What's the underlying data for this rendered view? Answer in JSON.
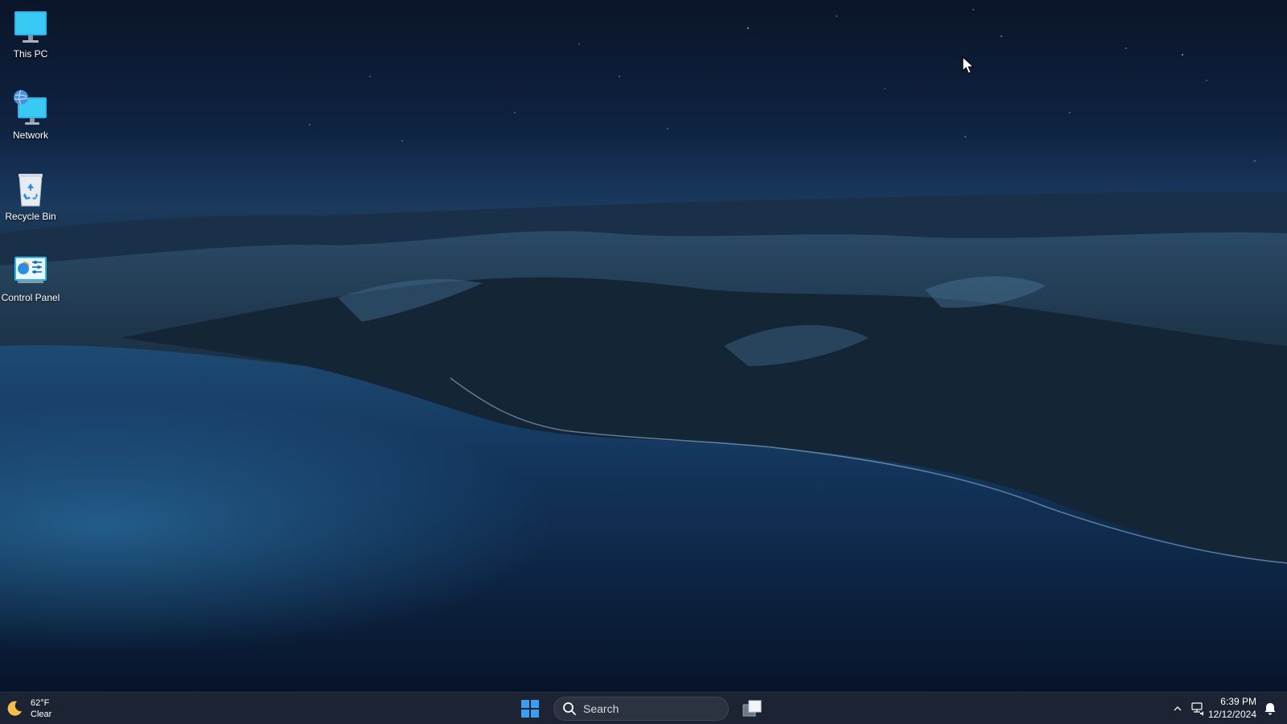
{
  "desktop": {
    "icons": [
      {
        "label": "This PC",
        "icon": "monitor-icon"
      },
      {
        "label": "Network",
        "icon": "network-icon"
      },
      {
        "label": "Recycle Bin",
        "icon": "recycle-bin-icon"
      },
      {
        "label": "Control Panel",
        "icon": "control-panel-icon"
      }
    ]
  },
  "taskbar": {
    "weather": {
      "temperature": "62°F",
      "condition": "Clear",
      "icon": "moon-icon"
    },
    "search": {
      "placeholder": "Search"
    },
    "clock": {
      "time": "6:39 PM",
      "date": "12/12/2024"
    }
  },
  "colors": {
    "taskbar_bg": "#1c2433",
    "accent": "#3b9cf0"
  }
}
